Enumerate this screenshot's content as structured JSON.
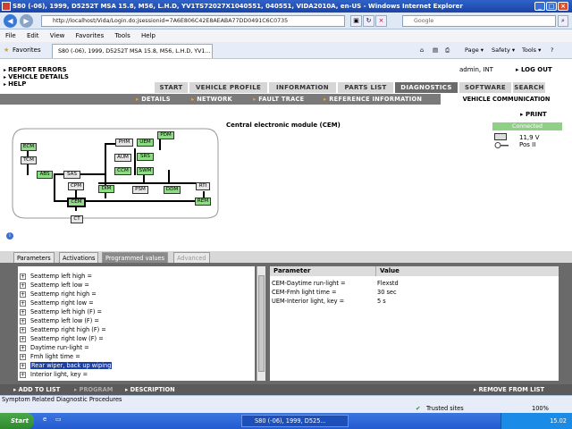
{
  "window": {
    "title": "S80 (-06), 1999, D5252T MSA 15.8, M56, L.H.D, YV1TS72027X1040551, 040551, VIDA2010A, en-US - Windows Internet Explorer"
  },
  "browser": {
    "url": "http://localhost/Vida/Login.do;jsessionid=7A6E806C42E8AEABA77DD0491C6C0735",
    "search_placeholder": "Google",
    "menu": [
      "File",
      "Edit",
      "View",
      "Favorites",
      "Tools",
      "Help"
    ],
    "favorites_label": "Favorites",
    "tab_title": "S80 (-06), 1999, D5252T MSA 15.8, M56, L.H.D, YV1...",
    "commands": [
      "Page ▾",
      "Safety ▾",
      "Tools ▾"
    ],
    "status_text": "Symptom Related Diagnostic Procedures",
    "trusted": "Trusted sites",
    "zoom": "100%"
  },
  "header": {
    "links": [
      "REPORT ERRORS",
      "VEHICLE DETAILS",
      "HELP"
    ],
    "user": "admin, INT",
    "logout": "LOG OUT"
  },
  "nav": {
    "tabs": [
      "START",
      "VEHICLE PROFILE",
      "INFORMATION",
      "PARTS LIST",
      "DIAGNOSTICS",
      "SOFTWARE",
      "SEARCH"
    ],
    "active_tab": "DIAGNOSTICS",
    "subtabs": [
      "DETAILS",
      "NETWORK",
      "FAULT TRACE",
      "REFERENCE INFORMATION"
    ],
    "active_subtab": "VEHICLE COMMUNICATION"
  },
  "module": {
    "title": "Central electronic module (CEM)",
    "print": "PRINT",
    "connection": "Connected",
    "voltage": "11,9 V",
    "position": "Pos II"
  },
  "network": {
    "ecus": [
      "ECM",
      "TCM",
      "ABS",
      "SAS",
      "CPM",
      "CEM",
      "CT",
      "PHM",
      "AUM",
      "CCM",
      "UEM",
      "PDM",
      "SRS",
      "SWM",
      "DIM",
      "PSM",
      "DDM",
      "RTI",
      "REM"
    ]
  },
  "lower_tabs": {
    "tabs": [
      "Parameters",
      "Activations",
      "Programmed values",
      "Advanced"
    ],
    "active": "Programmed values",
    "disabled": "Advanced"
  },
  "programmed_values": [
    "Seattemp left high =",
    "Seattemp left low =",
    "Seattemp right high =",
    "Seattemp right low =",
    "Seattemp left high (F) =",
    "Seattemp left low (F) =",
    "Seattemp right high (F) =",
    "Seattemp right low (F) =",
    "Daytime run-light =",
    "Fmh light time =",
    "Rear wiper, back up wiping",
    "Interior light, key ="
  ],
  "selected_item": "Rear wiper, back up wiping",
  "params": {
    "headers": [
      "Parameter",
      "Value"
    ],
    "rows": [
      [
        "CEM-Daytime run-light =",
        "Flexstd"
      ],
      [
        "CEM-Fmh light time =",
        "30 sec"
      ],
      [
        "UEM-Interior light, key =",
        "5 s"
      ]
    ]
  },
  "bottom": {
    "add": "ADD TO LIST",
    "program": "PROGRAM",
    "description": "DESCRIPTION",
    "remove": "REMOVE FROM LIST"
  },
  "taskbar": {
    "start": "Start",
    "task": "S80 (-06), 1999, D525...",
    "clock": "15.02"
  }
}
